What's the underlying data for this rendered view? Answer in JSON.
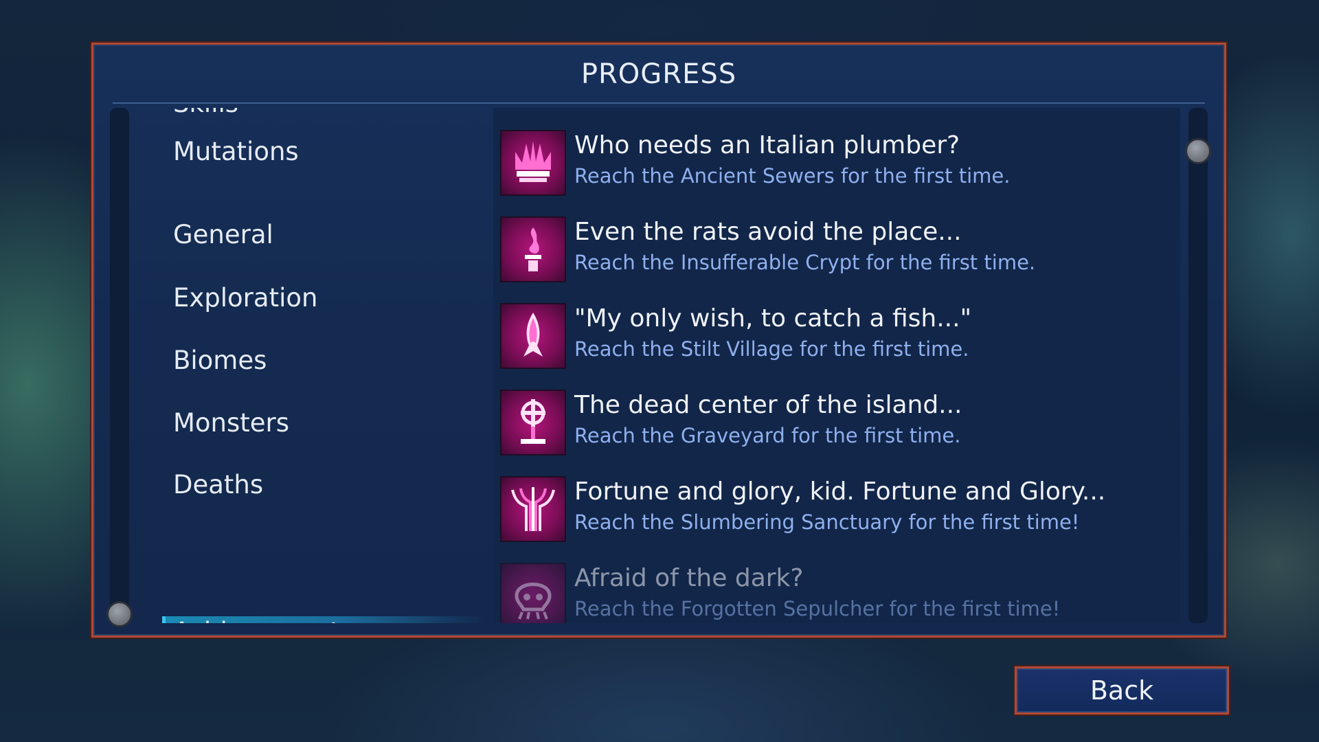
{
  "screen": {
    "title": "PROGRESS",
    "accent_border": "#b04a36",
    "selected_highlight": "#1b8bb4"
  },
  "categories": {
    "items": [
      {
        "label": "Skills"
      },
      {
        "label": "Mutations"
      },
      {
        "label": "General"
      },
      {
        "label": "Exploration"
      },
      {
        "label": "Biomes"
      },
      {
        "label": "Monsters"
      },
      {
        "label": "Deaths"
      },
      {
        "label": "Achievements"
      }
    ],
    "selected": "Achievements"
  },
  "achievements": {
    "items": [
      {
        "title": "Who needs an Italian plumber?",
        "description": "Reach the Ancient Sewers for the first time.",
        "icon": "crown-icon",
        "unlocked": true
      },
      {
        "title": "Even the rats avoid the place...",
        "description": "Reach the Insufferable Crypt for the first time.",
        "icon": "flame-pedestal-icon",
        "unlocked": true
      },
      {
        "title": "\"My only wish, to catch a fish...\"",
        "description": "Reach the Stilt Village for the first time.",
        "icon": "fish-icon",
        "unlocked": true
      },
      {
        "title": "The dead center of the island...",
        "description": "Reach the Graveyard for the first time.",
        "icon": "gravestone-cross-icon",
        "unlocked": true
      },
      {
        "title": "Fortune and glory, kid. Fortune and Glory...",
        "description": "Reach the Slumbering Sanctuary for the first time!",
        "icon": "pillars-icon",
        "unlocked": true
      },
      {
        "title": "Afraid of the dark?",
        "description": "Reach the Forgotten Sepulcher for the first time!",
        "icon": "skull-icon",
        "unlocked": false
      }
    ]
  },
  "buttons": {
    "back_label": "Back"
  }
}
